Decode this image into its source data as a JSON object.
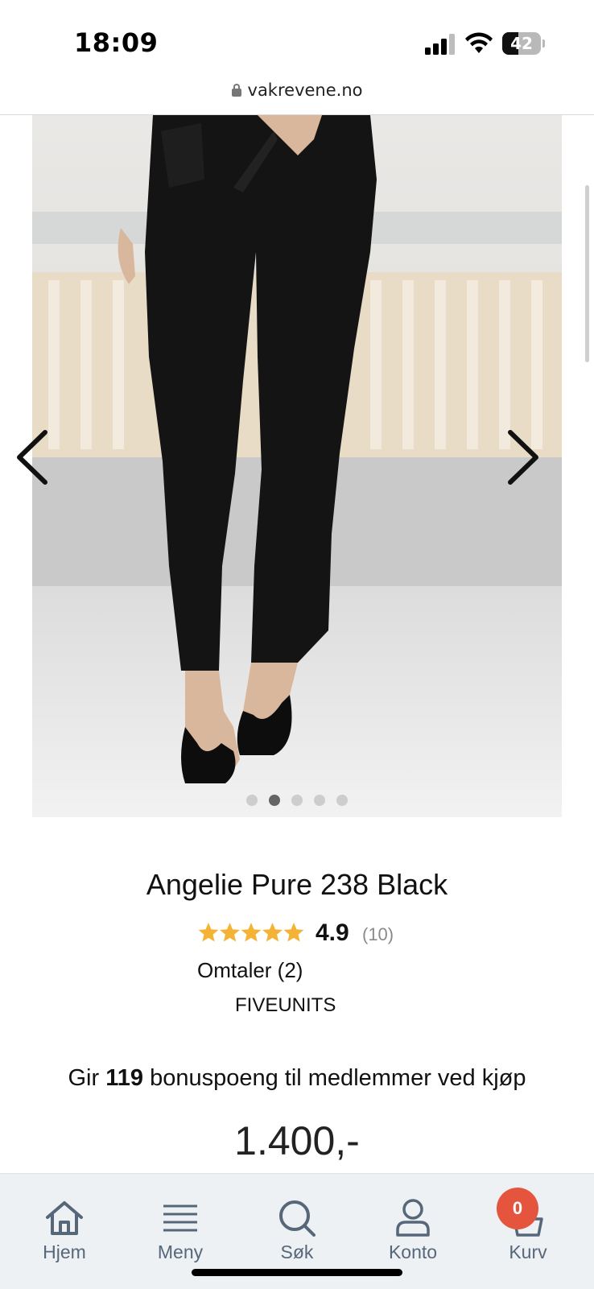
{
  "status_bar": {
    "time": "18:09",
    "battery_level": "42",
    "icons": [
      "signal-icon",
      "wifi-icon",
      "battery-icon"
    ]
  },
  "browser": {
    "url": "vakrevene.no"
  },
  "gallery": {
    "image_count": 5,
    "active_index": 1,
    "icons": [
      "chevron-left-icon",
      "chevron-right-icon"
    ]
  },
  "product": {
    "title": "Angelie Pure 238 Black",
    "rating": {
      "value": "4.9",
      "stars_out_of_5": 4.9,
      "count": "(10)"
    },
    "reviews_link": "Omtaler (2)",
    "brand": "FIVEUNITS",
    "bonus": {
      "prefix": "Gir",
      "points": "119",
      "suffix": "bonuspoeng til medlemmer ved kjøp"
    },
    "price": "1.400,-"
  },
  "bottom_nav": {
    "items": [
      {
        "label": "Hjem",
        "icon": "home-icon"
      },
      {
        "label": "Meny",
        "icon": "menu-icon"
      },
      {
        "label": "Søk",
        "icon": "search-icon"
      },
      {
        "label": "Konto",
        "icon": "account-icon"
      },
      {
        "label": "Kurv",
        "icon": "cart-icon"
      }
    ],
    "cart_count": "0"
  },
  "colors": {
    "star": "#f5b335",
    "star_empty": "#b8b8b8",
    "badge": "#e5553d",
    "nav_text": "#56677a",
    "nav_bg": "#eef1f4"
  }
}
